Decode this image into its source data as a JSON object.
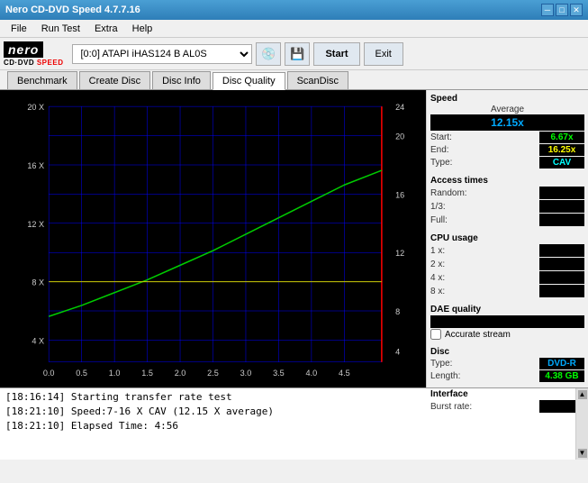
{
  "window": {
    "title": "Nero CD-DVD Speed 4.7.7.16",
    "minimize": "─",
    "maximize": "□",
    "close": "✕"
  },
  "menu": {
    "items": [
      "File",
      "Run Test",
      "Extra",
      "Help"
    ]
  },
  "toolbar": {
    "logo_nero": "nero",
    "logo_sub": "CD·DVD SPEED",
    "drive_label": "[0:0]  ATAPI iHAS124  B AL0S",
    "icon_cd": "💿",
    "icon_save": "💾",
    "start_label": "Start",
    "exit_label": "Exit"
  },
  "tabs": [
    {
      "label": "Benchmark",
      "active": false
    },
    {
      "label": "Create Disc",
      "active": false
    },
    {
      "label": "Disc Info",
      "active": false
    },
    {
      "label": "Disc Quality",
      "active": true
    },
    {
      "label": "ScanDisc",
      "active": false
    }
  ],
  "chart": {
    "y_labels_left": [
      "20 X",
      "16 X",
      "12 X",
      "8 X",
      "4 X"
    ],
    "y_labels_right": [
      "24",
      "20",
      "16",
      "12",
      "8",
      "4"
    ],
    "x_labels": [
      "0.0",
      "0.5",
      "1.0",
      "1.5",
      "2.0",
      "2.5",
      "3.0",
      "3.5",
      "4.0",
      "4.5"
    ]
  },
  "speed_panel": {
    "section_title": "Speed",
    "average_label": "Average",
    "average_value": "12.15x",
    "start_label": "Start:",
    "start_value": "6.67x",
    "end_label": "End:",
    "end_value": "16.25x",
    "type_label": "Type:",
    "type_value": "CAV"
  },
  "access_panel": {
    "section_title": "Access times",
    "random_label": "Random:",
    "random_value": "",
    "onethird_label": "1/3:",
    "onethird_value": "",
    "full_label": "Full:",
    "full_value": ""
  },
  "cpu_panel": {
    "section_title": "CPU usage",
    "onex_label": "1 x:",
    "onex_value": "",
    "twox_label": "2 x:",
    "twox_value": "",
    "fourx_label": "4 x:",
    "fourx_value": "",
    "eightx_label": "8 x:",
    "eightx_value": ""
  },
  "dae_panel": {
    "section_title": "DAE quality",
    "dae_value": "",
    "accurate_stream_label": "Accurate stream"
  },
  "disc_panel": {
    "section_title": "Disc",
    "type_label": "Type:",
    "type_value": "DVD-R",
    "length_label": "Length:",
    "length_value": "4.38 GB"
  },
  "interface_panel": {
    "section_title": "Interface",
    "burst_label": "Burst rate:",
    "burst_value": ""
  },
  "log": {
    "title": "",
    "entries": [
      "[18:16:14]  Starting transfer rate test",
      "[18:21:10]  Speed:7-16 X CAV (12.15 X average)",
      "[18:21:10]  Elapsed Time: 4:56"
    ]
  }
}
